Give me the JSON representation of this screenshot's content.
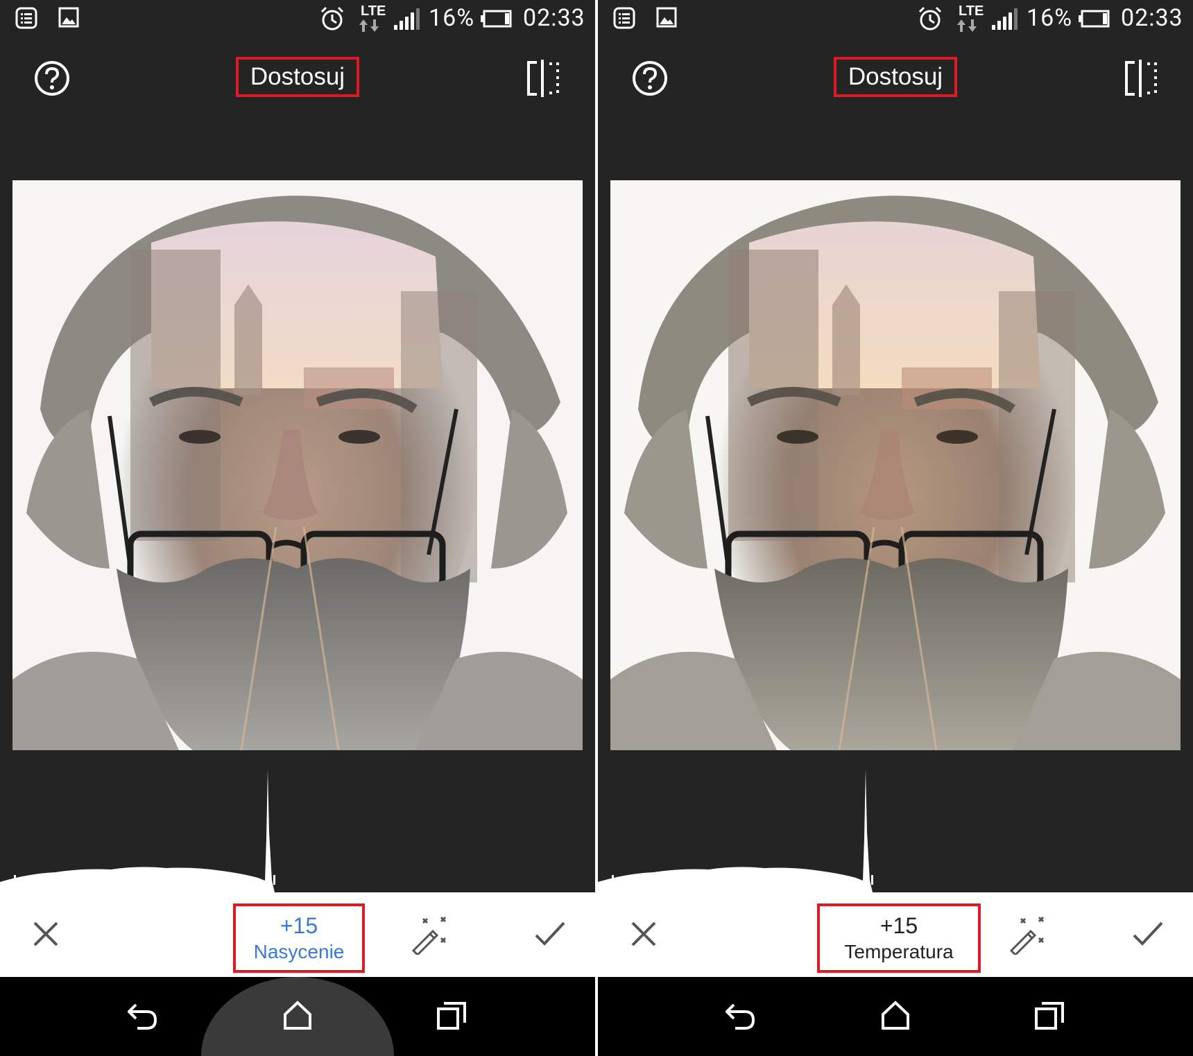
{
  "status_bar": {
    "battery_percent": "16%",
    "time": "02:33",
    "network": "LTE"
  },
  "left_screen": {
    "title": "Dostosuj",
    "adjust_value": "+15",
    "adjust_label": "Nasycenie",
    "value_color": "#3a78d8"
  },
  "right_screen": {
    "title": "Dostosuj",
    "adjust_value": "+15",
    "adjust_label": "Temperatura",
    "value_color": "#222222"
  },
  "icons": {
    "help": "help-circle-icon",
    "compare": "compare-split-icon",
    "cancel": "close-icon",
    "auto": "magic-wand-icon",
    "apply": "checkmark-icon",
    "back": "back-icon",
    "home": "home-icon",
    "recent": "recent-apps-icon"
  },
  "colors": {
    "highlight_box": "#e01a22",
    "app_background": "#242424"
  }
}
